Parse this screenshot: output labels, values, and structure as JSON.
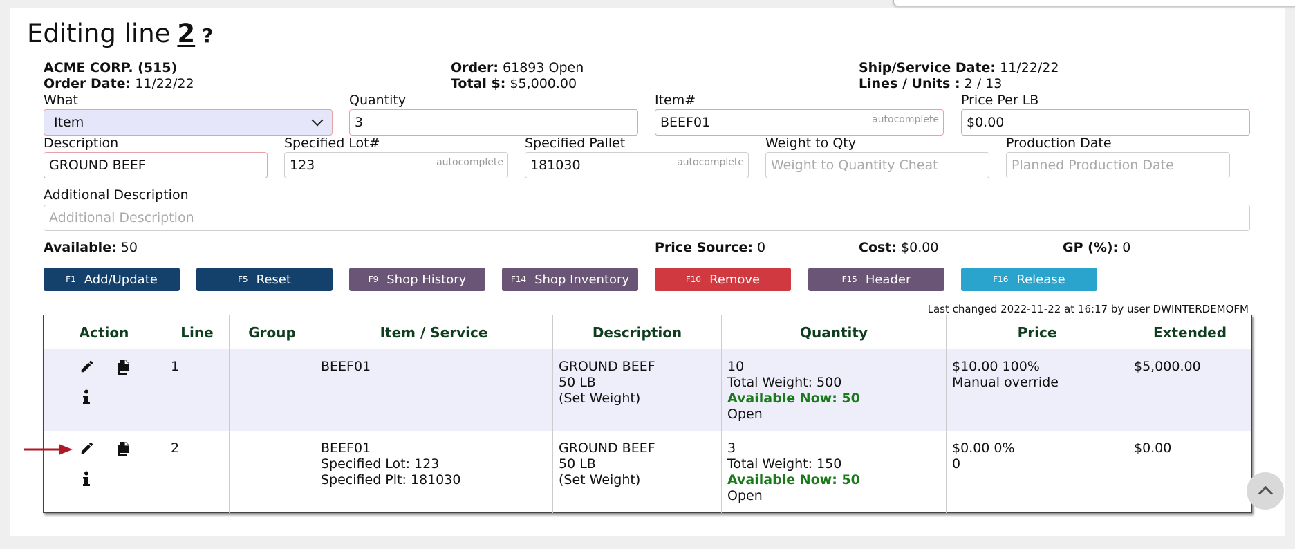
{
  "page": {
    "title_prefix": "Editing line",
    "line_number": "2",
    "help_mark": "?"
  },
  "header": {
    "customer": "ACME CORP. (515)",
    "order_date_label": "Order Date:",
    "order_date": "11/22/22",
    "order_label": "Order:",
    "order_value": "61893 Open",
    "total_label": "Total $:",
    "total_value": "$5,000.00",
    "ship_label": "Ship/Service Date:",
    "ship_value": "11/22/22",
    "lines_label": "Lines / Units :",
    "lines_value": "2 / 13"
  },
  "form": {
    "what_label": "What",
    "what_value": "Item",
    "quantity_label": "Quantity",
    "quantity_value": "3",
    "item_label": "Item#",
    "item_value": "BEEF01",
    "price_label": "Price Per LB",
    "price_value": "$0.00",
    "description_label": "Description",
    "description_value": "GROUND BEEF",
    "lot_label": "Specified Lot#",
    "lot_value": "123",
    "pallet_label": "Specified Pallet",
    "pallet_value": "181030",
    "weight_label": "Weight to Qty",
    "weight_placeholder": "Weight to Quantity Cheat",
    "prod_label": "Production Date",
    "prod_placeholder": "Planned Production Date",
    "addl_label": "Additional Description",
    "addl_placeholder": "Additional Description",
    "autocomplete": "autocomplete"
  },
  "summary": {
    "available_label": "Available:",
    "available_value": "50",
    "price_source_label": "Price Source:",
    "price_source_value": "0",
    "cost_label": "Cost:",
    "cost_value": "$0.00",
    "gp_label": "GP (%):",
    "gp_value": "0"
  },
  "buttons": [
    {
      "key": "F1",
      "label": "Add/Update",
      "color": "#13416b"
    },
    {
      "key": "F5",
      "label": "Reset",
      "color": "#13416b"
    },
    {
      "key": "F9",
      "label": "Shop History",
      "color": "#6b5577"
    },
    {
      "key": "F14",
      "label": "Shop Inventory",
      "color": "#6b5577"
    },
    {
      "key": "F10",
      "label": "Remove",
      "color": "#d0393f"
    },
    {
      "key": "F15",
      "label": "Header",
      "color": "#6b5577"
    },
    {
      "key": "F16",
      "label": "Release",
      "color": "#2aa4cd"
    }
  ],
  "last_changed": "Last changed 2022-11-22 at 16:17 by user DWINTERDEMOFM",
  "table": {
    "columns": [
      "Action",
      "Line",
      "Group",
      "Item / Service",
      "Description",
      "Quantity",
      "Price",
      "Extended"
    ],
    "rows": [
      {
        "line": "1",
        "group": "",
        "item": [
          "BEEF01"
        ],
        "description": [
          "GROUND BEEF",
          "50 LB",
          "(Set Weight)"
        ],
        "quantity": "10",
        "total_weight": "Total Weight: 500",
        "available_now": "Available Now: 50",
        "status": "Open",
        "price": [
          "$10.00 100%",
          "Manual override"
        ],
        "extended": "$5,000.00"
      },
      {
        "line": "2",
        "group": "",
        "item": [
          "BEEF01",
          "Specified Lot: 123",
          "Specified Plt: 181030"
        ],
        "description": [
          "GROUND BEEF",
          "50 LB",
          "(Set Weight)"
        ],
        "quantity": "3",
        "total_weight": "Total Weight: 150",
        "available_now": "Available Now: 50",
        "status": "Open",
        "price": [
          "$0.00 0%",
          "0"
        ],
        "extended": "$0.00"
      }
    ]
  },
  "colors": {
    "accent_navy": "#13416b",
    "accent_purple": "#6b5577",
    "danger": "#d0393f",
    "info": "#2aa4cd",
    "available_green": "#1a7a1a",
    "arrow_red": "#b0182a"
  }
}
